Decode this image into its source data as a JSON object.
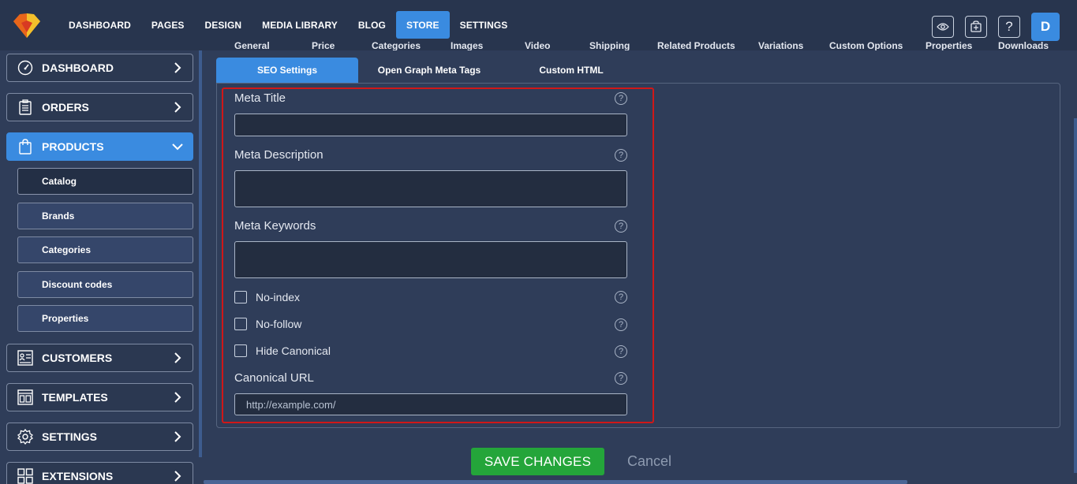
{
  "topnav": {
    "items": [
      "DASHBOARD",
      "PAGES",
      "DESIGN",
      "MEDIA LIBRARY",
      "BLOG",
      "STORE",
      "SETTINGS"
    ],
    "active_index": 5,
    "icons": [
      "eye-icon",
      "cart-icon",
      "help-icon"
    ],
    "avatar_letter": "D"
  },
  "sidebar": {
    "items": [
      {
        "label": "DASHBOARD",
        "icon": "gauge-icon",
        "expanded": false
      },
      {
        "label": "ORDERS",
        "icon": "clipboard-icon",
        "expanded": false
      },
      {
        "label": "PRODUCTS",
        "icon": "bag-icon",
        "expanded": true
      },
      {
        "label": "CUSTOMERS",
        "icon": "contact-card-icon",
        "expanded": false
      },
      {
        "label": "TEMPLATES",
        "icon": "template-icon",
        "expanded": false
      },
      {
        "label": "SETTINGS",
        "icon": "gear-icon",
        "expanded": false
      },
      {
        "label": "EXTENSIONS",
        "icon": "grid-icon",
        "expanded": false
      }
    ],
    "products_sub": [
      "Catalog",
      "Brands",
      "Categories",
      "Discount codes",
      "Properties"
    ],
    "products_sub_active": 0
  },
  "product_tabs": [
    "General",
    "Price",
    "Categories",
    "Images",
    "Video",
    "Shipping",
    "Related Products",
    "Variations",
    "Custom Options",
    "Properties",
    "Downloads"
  ],
  "seo_tabs": [
    "SEO Settings",
    "Open Graph Meta Tags",
    "Custom HTML"
  ],
  "seo_tabs_active": 0,
  "form": {
    "meta_title_label": "Meta Title",
    "meta_title_value": "",
    "meta_description_label": "Meta Description",
    "meta_description_value": "",
    "meta_keywords_label": "Meta Keywords",
    "meta_keywords_value": "",
    "noindex_label": "No-index",
    "nofollow_label": "No-follow",
    "hide_canonical_label": "Hide Canonical",
    "canonical_label": "Canonical URL",
    "canonical_placeholder": "http://example.com/",
    "help_glyph": "?"
  },
  "actions": {
    "save_label": "SAVE CHANGES",
    "cancel_label": "Cancel"
  },
  "colors": {
    "accent": "#3a8be0",
    "save": "#24a53a",
    "highlight": "#d01818",
    "background": "#2f3d59"
  }
}
